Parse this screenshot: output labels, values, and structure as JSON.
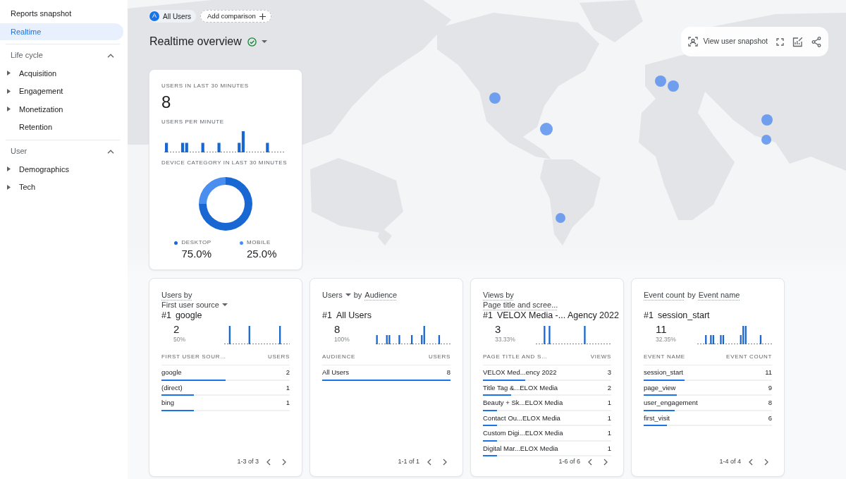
{
  "sidebar": {
    "items": [
      {
        "label": "Reports snapshot",
        "selected": false
      },
      {
        "label": "Realtime",
        "selected": true
      }
    ],
    "sections": [
      {
        "title": "Life cycle",
        "expanded": true,
        "items": [
          {
            "kind": "group",
            "label": "Acquisition"
          },
          {
            "kind": "group",
            "label": "Engagement"
          },
          {
            "kind": "group",
            "label": "Monetization"
          },
          {
            "kind": "page",
            "label": "Retention"
          }
        ]
      },
      {
        "title": "User",
        "expanded": true,
        "items": [
          {
            "kind": "group",
            "label": "Demographics"
          },
          {
            "kind": "group",
            "label": "Tech"
          }
        ]
      }
    ]
  },
  "comparisons": {
    "audience": {
      "initial": "A",
      "label": "All Users"
    },
    "add_button": "Add comparison"
  },
  "page_title": "Realtime overview",
  "toolbar": {
    "snapshot_button": "View user snapshot"
  },
  "summary_card": {
    "users_label": "USERS IN LAST 30 MINUTES",
    "users_value": "8",
    "per_minute_label": "USERS PER MINUTE",
    "device_label": "DEVICE CATEGORY IN LAST 30 MINUTES",
    "chart_data": {
      "type": "donut",
      "categories": [
        "DESKTOP",
        "MOBILE"
      ],
      "values": [
        75,
        25
      ],
      "colors": [
        "#1967d2",
        "#4a8ff0"
      ]
    },
    "device_shares": [
      "75.0%",
      "25.0%"
    ]
  },
  "cards": [
    {
      "title_lines": [
        [
          {
            "kind": "link",
            "text": "Users by"
          }
        ],
        [
          {
            "kind": "dropdown",
            "text": "First user source"
          }
        ]
      ],
      "rank": "#1",
      "top_item": "google",
      "value": "2",
      "share": "50%",
      "columns": [
        "FIRST USER SOUR…",
        "USERS"
      ],
      "rows": [
        {
          "label": "google",
          "value": "2",
          "level": 0.5
        },
        {
          "label": "(direct)",
          "value": "1",
          "level": 0.25
        },
        {
          "label": "bing",
          "value": "1",
          "level": 0.25
        }
      ],
      "pagination": "1-3 of 3"
    },
    {
      "title_lines": [
        [
          {
            "kind": "dropdown",
            "text": "Users"
          },
          {
            "kind": "plain",
            "text": "by"
          },
          {
            "kind": "link",
            "text": "Audience"
          }
        ]
      ],
      "rank": "#1",
      "top_item": "All Users",
      "value": "8",
      "share": "100%",
      "columns": [
        "AUDIENCE",
        "USERS"
      ],
      "rows": [
        {
          "label": "All Users",
          "value": "8",
          "level": 1
        }
      ],
      "pagination": "1-1 of 1"
    },
    {
      "title_lines": [
        [
          {
            "kind": "link",
            "text": "Views by"
          }
        ],
        [
          {
            "kind": "link",
            "text": "Page title and scree..."
          }
        ]
      ],
      "rank": "#1",
      "top_item": "VELOX Media -... Agency 2022",
      "value": "3",
      "share": "33.33%",
      "columns": [
        "PAGE TITLE AND S…",
        "VIEWS"
      ],
      "rows": [
        {
          "label": "VELOX Med...ency 2022",
          "value": "3",
          "level": 0.33
        },
        {
          "label": "Title Tag &...ELOX Media",
          "value": "2",
          "level": 0.22
        },
        {
          "label": "Beauty + Sk...ELOX Media",
          "value": "1",
          "level": 0.11
        },
        {
          "label": "Contact Ou...ELOX Media",
          "value": "1",
          "level": 0.11
        },
        {
          "label": "Custom Digi...ELOX Media",
          "value": "1",
          "level": 0.11
        },
        {
          "label": "Digital Mar...ELOX Media",
          "value": "1",
          "level": 0.11
        }
      ],
      "pagination": "1-6 of 6"
    },
    {
      "title_lines": [
        [
          {
            "kind": "link",
            "text": "Event count"
          },
          {
            "kind": "plain",
            "text": "by"
          },
          {
            "kind": "link",
            "text": "Event name"
          }
        ]
      ],
      "rank": "#1",
      "top_item": "session_start",
      "value": "11",
      "share": "32.35%",
      "columns": [
        "EVENT NAME",
        "EVENT COUNT"
      ],
      "rows": [
        {
          "label": "session_start",
          "value": "11",
          "level": 0.32
        },
        {
          "label": "page_view",
          "value": "9",
          "level": 0.26
        },
        {
          "label": "user_engagement",
          "value": "8",
          "level": 0.24
        },
        {
          "label": "first_visit",
          "value": "6",
          "level": 0.18
        }
      ],
      "pagination": "1-4 of 4"
    }
  ]
}
